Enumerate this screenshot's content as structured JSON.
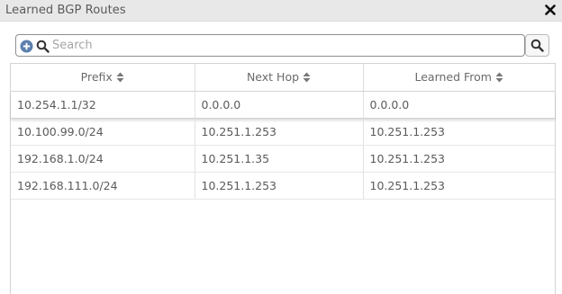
{
  "window": {
    "title": "Learned BGP Routes",
    "close_label": "✕"
  },
  "search": {
    "placeholder": "Search",
    "value": ""
  },
  "table": {
    "columns": [
      "Prefix",
      "Next Hop",
      "Learned From"
    ],
    "rows": [
      {
        "prefix": "10.254.1.1/32",
        "next_hop": "0.0.0.0",
        "learned_from": "0.0.0.0",
        "selected": true
      },
      {
        "prefix": "10.100.99.0/24",
        "next_hop": "10.251.1.253",
        "learned_from": "10.251.1.253",
        "selected": false
      },
      {
        "prefix": "192.168.1.0/24",
        "next_hop": "10.251.1.35",
        "learned_from": "10.251.1.253",
        "selected": false
      },
      {
        "prefix": "192.168.111.0/24",
        "next_hop": "10.251.1.253",
        "learned_from": "10.251.1.253",
        "selected": false
      }
    ]
  },
  "icons": {
    "add": "plus-circle-icon",
    "search": "magnifier-icon",
    "sort": "sort-both-icon",
    "close": "close-icon"
  },
  "colors": {
    "add_icon": "#5b7fae",
    "titlebar": "#e8e8e8",
    "text": "#5a5a5a"
  }
}
